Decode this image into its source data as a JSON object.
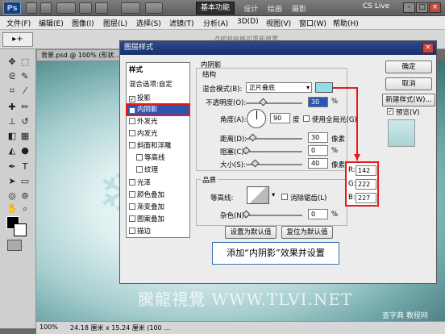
{
  "app": {
    "logo": "Ps",
    "workspace_active": "基本功能",
    "workspaces": [
      "设计",
      "绘画",
      "摄影"
    ],
    "cs_live": "CS Live",
    "win_buttons": [
      "-",
      "□",
      "×"
    ]
  },
  "menubar": [
    "文件(F)",
    "编辑(E)",
    "图像(I)",
    "图层(L)",
    "选择(S)",
    "滤镜(T)",
    "分析(A)",
    "3D(D)",
    "视图(V)",
    "窗口(W)",
    "帮助(H)"
  ],
  "optbar": {
    "tool": "▸+",
    "faint_text": "点按并拖移可重新放置"
  },
  "document": {
    "tab": "背景.psd @ 100% (形状…",
    "zoom": "100%",
    "size_info": "24.18 厘米 x 15.24 厘米 (100 …"
  },
  "dialog": {
    "title": "图层样式",
    "close": "×",
    "styles_header": "样式",
    "blend_options": "混合选项:自定",
    "items": [
      {
        "label": "投影",
        "checked": true
      },
      {
        "label": "内阴影",
        "checked": true,
        "selected": true
      },
      {
        "label": "外发光",
        "checked": false
      },
      {
        "label": "内发光",
        "checked": false
      },
      {
        "label": "斜面和浮雕",
        "checked": false
      },
      {
        "label": "等高线",
        "checked": false,
        "sub": true
      },
      {
        "label": "纹理",
        "checked": false,
        "sub": true
      },
      {
        "label": "光泽",
        "checked": false
      },
      {
        "label": "颜色叠加",
        "checked": false
      },
      {
        "label": "渐变叠加",
        "checked": false
      },
      {
        "label": "图案叠加",
        "checked": false
      },
      {
        "label": "描边",
        "checked": false
      }
    ],
    "section_title": "内阴影",
    "structure": {
      "title": "结构",
      "blend_mode_label": "混合模式(B):",
      "blend_mode_value": "正片叠底",
      "blend_color": "#8edee3",
      "opacity_label": "不透明度(O):",
      "opacity_value": "30",
      "opacity_unit": "%",
      "opacity_level": 0.3,
      "angle_label": "角度(A):",
      "angle_value": "90",
      "angle_unit": "度",
      "global_light_label": "使用全局光(G)",
      "global_light_checked": false,
      "distance_label": "距离(D):",
      "distance_value": "30",
      "distance_unit": "像素",
      "distance_level": 0.12,
      "choke_label": "阻塞(C):",
      "choke_value": "0",
      "choke_unit": "%",
      "choke_level": 0.0,
      "size_label": "大小(S):",
      "size_value": "40",
      "size_unit": "像素",
      "size_level": 0.16
    },
    "quality": {
      "title": "品质",
      "contour_label": "等高线:",
      "antialias_label": "消除锯齿(L)",
      "antialias_checked": false,
      "noise_label": "杂色(N):",
      "noise_value": "0",
      "noise_unit": "%",
      "noise_level": 0.0
    },
    "buttons": {
      "set_default": "设置为默认值",
      "reset_default": "复位为默认值",
      "ok": "确定",
      "cancel": "取消",
      "new_style": "新建样式(W)...",
      "preview": "预览(V)",
      "preview_checked": true
    }
  },
  "rgb": {
    "r_label": "R:",
    "r": "142",
    "g_label": "G:",
    "g": "222",
    "b_label": "B:",
    "b": "227"
  },
  "annotation": "添加“内阴影”效果并设置",
  "watermark": "騰龍視覺 WWW.TLVI.NET",
  "watermark2": "查字典 教程网"
}
